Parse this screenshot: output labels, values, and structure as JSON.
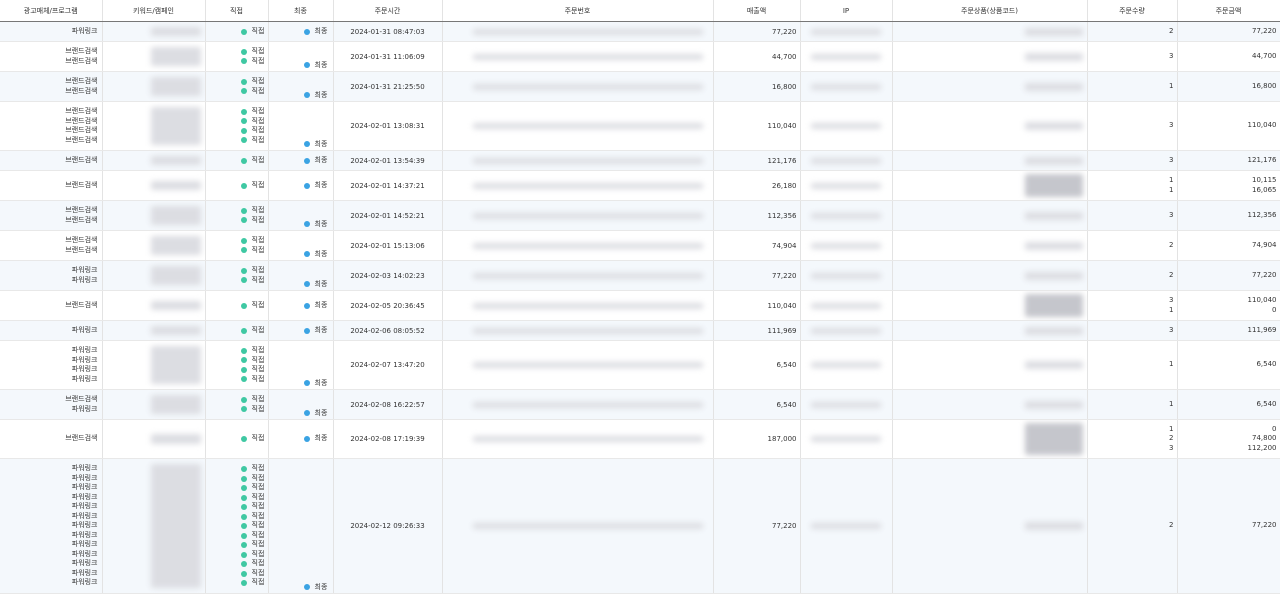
{
  "headers": {
    "medium": "광고매체/프로그램",
    "keyword": "키워드/캠페인",
    "direct": "직접",
    "final": "최종",
    "order_time": "주문시간",
    "order_no": "주문번호",
    "sales": "매출액",
    "ip": "IP",
    "product": "주문상품(상품코드)",
    "qty": "주문수량",
    "amount": "주문금액"
  },
  "labels": {
    "direct": "직접",
    "final": "최종"
  },
  "colors": {
    "direct_dot": "#3fc8a3",
    "final_dot": "#3aa3e3",
    "alt_row": "#f4f8fc"
  },
  "rows": [
    {
      "media": [
        "파워링크"
      ],
      "time": "2024-01-31 08:47:03",
      "sales": "77,220",
      "qty": [
        "2"
      ],
      "amount": [
        "77,220"
      ]
    },
    {
      "media": [
        "브랜드검색",
        "브랜드검색"
      ],
      "time": "2024-01-31 11:06:09",
      "sales": "44,700",
      "qty": [
        "3"
      ],
      "amount": [
        "44,700"
      ]
    },
    {
      "media": [
        "브랜드검색",
        "브랜드검색"
      ],
      "time": "2024-01-31 21:25:50",
      "sales": "16,800",
      "qty": [
        "1"
      ],
      "amount": [
        "16,800"
      ]
    },
    {
      "media": [
        "브랜드검색",
        "브랜드검색",
        "브랜드검색",
        "브랜드검색"
      ],
      "time": "2024-02-01 13:08:31",
      "sales": "110,040",
      "qty": [
        "3"
      ],
      "amount": [
        "110,040"
      ]
    },
    {
      "media": [
        "브랜드검색"
      ],
      "time": "2024-02-01 13:54:39",
      "sales": "121,176",
      "qty": [
        "3"
      ],
      "amount": [
        "121,176"
      ]
    },
    {
      "media": [
        "브랜드검색"
      ],
      "time": "2024-02-01 14:37:21",
      "sales": "26,180",
      "qty": [
        "1",
        "1"
      ],
      "amount": [
        "10,115",
        "16,065"
      ]
    },
    {
      "media": [
        "브랜드검색",
        "브랜드검색"
      ],
      "time": "2024-02-01 14:52:21",
      "sales": "112,356",
      "qty": [
        "3"
      ],
      "amount": [
        "112,356"
      ]
    },
    {
      "media": [
        "브랜드검색",
        "브랜드검색"
      ],
      "time": "2024-02-01 15:13:06",
      "sales": "74,904",
      "qty": [
        "2"
      ],
      "amount": [
        "74,904"
      ]
    },
    {
      "media": [
        "파워링크",
        "파워링크"
      ],
      "time": "2024-02-03 14:02:23",
      "sales": "77,220",
      "qty": [
        "2"
      ],
      "amount": [
        "77,220"
      ]
    },
    {
      "media": [
        "브랜드검색"
      ],
      "time": "2024-02-05 20:36:45",
      "sales": "110,040",
      "qty": [
        "3",
        "1"
      ],
      "amount": [
        "110,040",
        "0"
      ]
    },
    {
      "media": [
        "파워링크"
      ],
      "time": "2024-02-06 08:05:52",
      "sales": "111,969",
      "qty": [
        "3"
      ],
      "amount": [
        "111,969"
      ]
    },
    {
      "media": [
        "파워링크",
        "파워링크",
        "파워링크",
        "파워링크"
      ],
      "time": "2024-02-07 13:47:20",
      "sales": "6,540",
      "qty": [
        "1"
      ],
      "amount": [
        "6,540"
      ]
    },
    {
      "media": [
        "브랜드검색",
        "파워링크"
      ],
      "time": "2024-02-08 16:22:57",
      "sales": "6,540",
      "qty": [
        "1"
      ],
      "amount": [
        "6,540"
      ]
    },
    {
      "media": [
        "브랜드검색"
      ],
      "time": "2024-02-08 17:19:39",
      "sales": "187,000",
      "qty": [
        "1",
        "2",
        "3"
      ],
      "amount": [
        "0",
        "74,800",
        "112,200"
      ]
    },
    {
      "media": [
        "파워링크",
        "파워링크",
        "파워링크",
        "파워링크",
        "파워링크",
        "파워링크",
        "파워링크",
        "파워링크",
        "파워링크",
        "파워링크",
        "파워링크",
        "파워링크",
        "파워링크"
      ],
      "time": "2024-02-12 09:26:33",
      "sales": "77,220",
      "qty": [
        "2"
      ],
      "amount": [
        "77,220"
      ]
    }
  ]
}
